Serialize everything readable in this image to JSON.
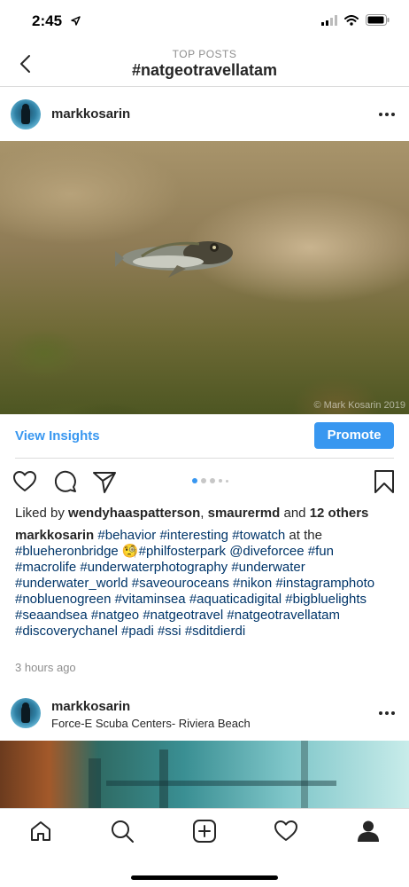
{
  "status_bar": {
    "time": "2:45",
    "icons": [
      "location-arrow-icon",
      "cellular-signal-icon",
      "wifi-icon",
      "battery-icon"
    ]
  },
  "header": {
    "subtitle": "TOP POSTS",
    "title": "#natgeotravellatam",
    "back_icon": "chevron-left-icon"
  },
  "post": {
    "username": "markkosarin",
    "image_watermark": "© Mark Kosarin 2019",
    "view_insights_label": "View Insights",
    "promote_label": "Promote",
    "carousel": {
      "count": 5,
      "active_index": 0
    },
    "likes": {
      "prefix": "Liked by ",
      "user1": "wendyhaaspatterson",
      "separator": ", ",
      "user2": "smaurermd",
      "and": " and ",
      "others": "12 others"
    },
    "caption": {
      "user": "markkosarin",
      "segments": [
        {
          "text": " ",
          "tag": false
        },
        {
          "text": "#behavior",
          "tag": true
        },
        {
          "text": " ",
          "tag": false
        },
        {
          "text": "#interesting",
          "tag": true
        },
        {
          "text": " ",
          "tag": false
        },
        {
          "text": "#towatch",
          "tag": true
        },
        {
          "text": " at the ",
          "tag": false
        },
        {
          "text": "#blueheronbridge",
          "tag": true
        },
        {
          "text": " 🧐",
          "tag": false
        },
        {
          "text": "#philfosterpark",
          "tag": true
        },
        {
          "text": " ",
          "tag": false
        },
        {
          "text": "@diveforcee",
          "tag": true
        },
        {
          "text": " ",
          "tag": false
        },
        {
          "text": "#fun",
          "tag": true
        },
        {
          "text": " ",
          "tag": false
        },
        {
          "text": "#macrolife",
          "tag": true
        },
        {
          "text": " ",
          "tag": false
        },
        {
          "text": "#underwaterphotography",
          "tag": true
        },
        {
          "text": " ",
          "tag": false
        },
        {
          "text": "#underwater",
          "tag": true
        },
        {
          "text": " ",
          "tag": false
        },
        {
          "text": "#underwater_world",
          "tag": true
        },
        {
          "text": " ",
          "tag": false
        },
        {
          "text": "#saveouroceans",
          "tag": true
        },
        {
          "text": " ",
          "tag": false
        },
        {
          "text": "#nikon",
          "tag": true
        },
        {
          "text": " ",
          "tag": false
        },
        {
          "text": "#instagramphoto",
          "tag": true
        },
        {
          "text": " ",
          "tag": false
        },
        {
          "text": "#nobluenogreen",
          "tag": true
        },
        {
          "text": " ",
          "tag": false
        },
        {
          "text": "#vitaminsea",
          "tag": true
        },
        {
          "text": " ",
          "tag": false
        },
        {
          "text": "#aquaticadigital",
          "tag": true
        },
        {
          "text": " ",
          "tag": false
        },
        {
          "text": "#bigbluelights",
          "tag": true
        },
        {
          "text": " ",
          "tag": false
        },
        {
          "text": "#seaandsea",
          "tag": true
        },
        {
          "text": " ",
          "tag": false
        },
        {
          "text": "#natgeo",
          "tag": true
        },
        {
          "text": " ",
          "tag": false
        },
        {
          "text": "#natgeotravel",
          "tag": true
        },
        {
          "text": " ",
          "tag": false
        },
        {
          "text": "#natgeotravellatam",
          "tag": true
        },
        {
          "text": " ",
          "tag": false
        },
        {
          "text": "#discoverychanel",
          "tag": true
        },
        {
          "text": " ",
          "tag": false
        },
        {
          "text": "#padi",
          "tag": true
        },
        {
          "text": " ",
          "tag": false
        },
        {
          "text": "#ssi",
          "tag": true
        },
        {
          "text": " ",
          "tag": false
        },
        {
          "text": "#sditdierdi",
          "tag": true
        }
      ]
    },
    "timestamp": "3 hours ago",
    "icons": [
      "heart-icon",
      "comment-icon",
      "share-icon",
      "bookmark-icon",
      "more-options-icon"
    ]
  },
  "post2": {
    "username": "markkosarin",
    "location": "Force-E Scuba Centers- Riviera Beach"
  },
  "tab_bar": {
    "icons": [
      "home-icon",
      "search-icon",
      "new-post-icon",
      "activity-heart-icon",
      "profile-icon"
    ]
  },
  "colors": {
    "link_blue": "#3897f0",
    "hashtag": "#003569",
    "text": "#262626",
    "muted": "#8e8e8e",
    "divider": "#dbdbdb"
  }
}
